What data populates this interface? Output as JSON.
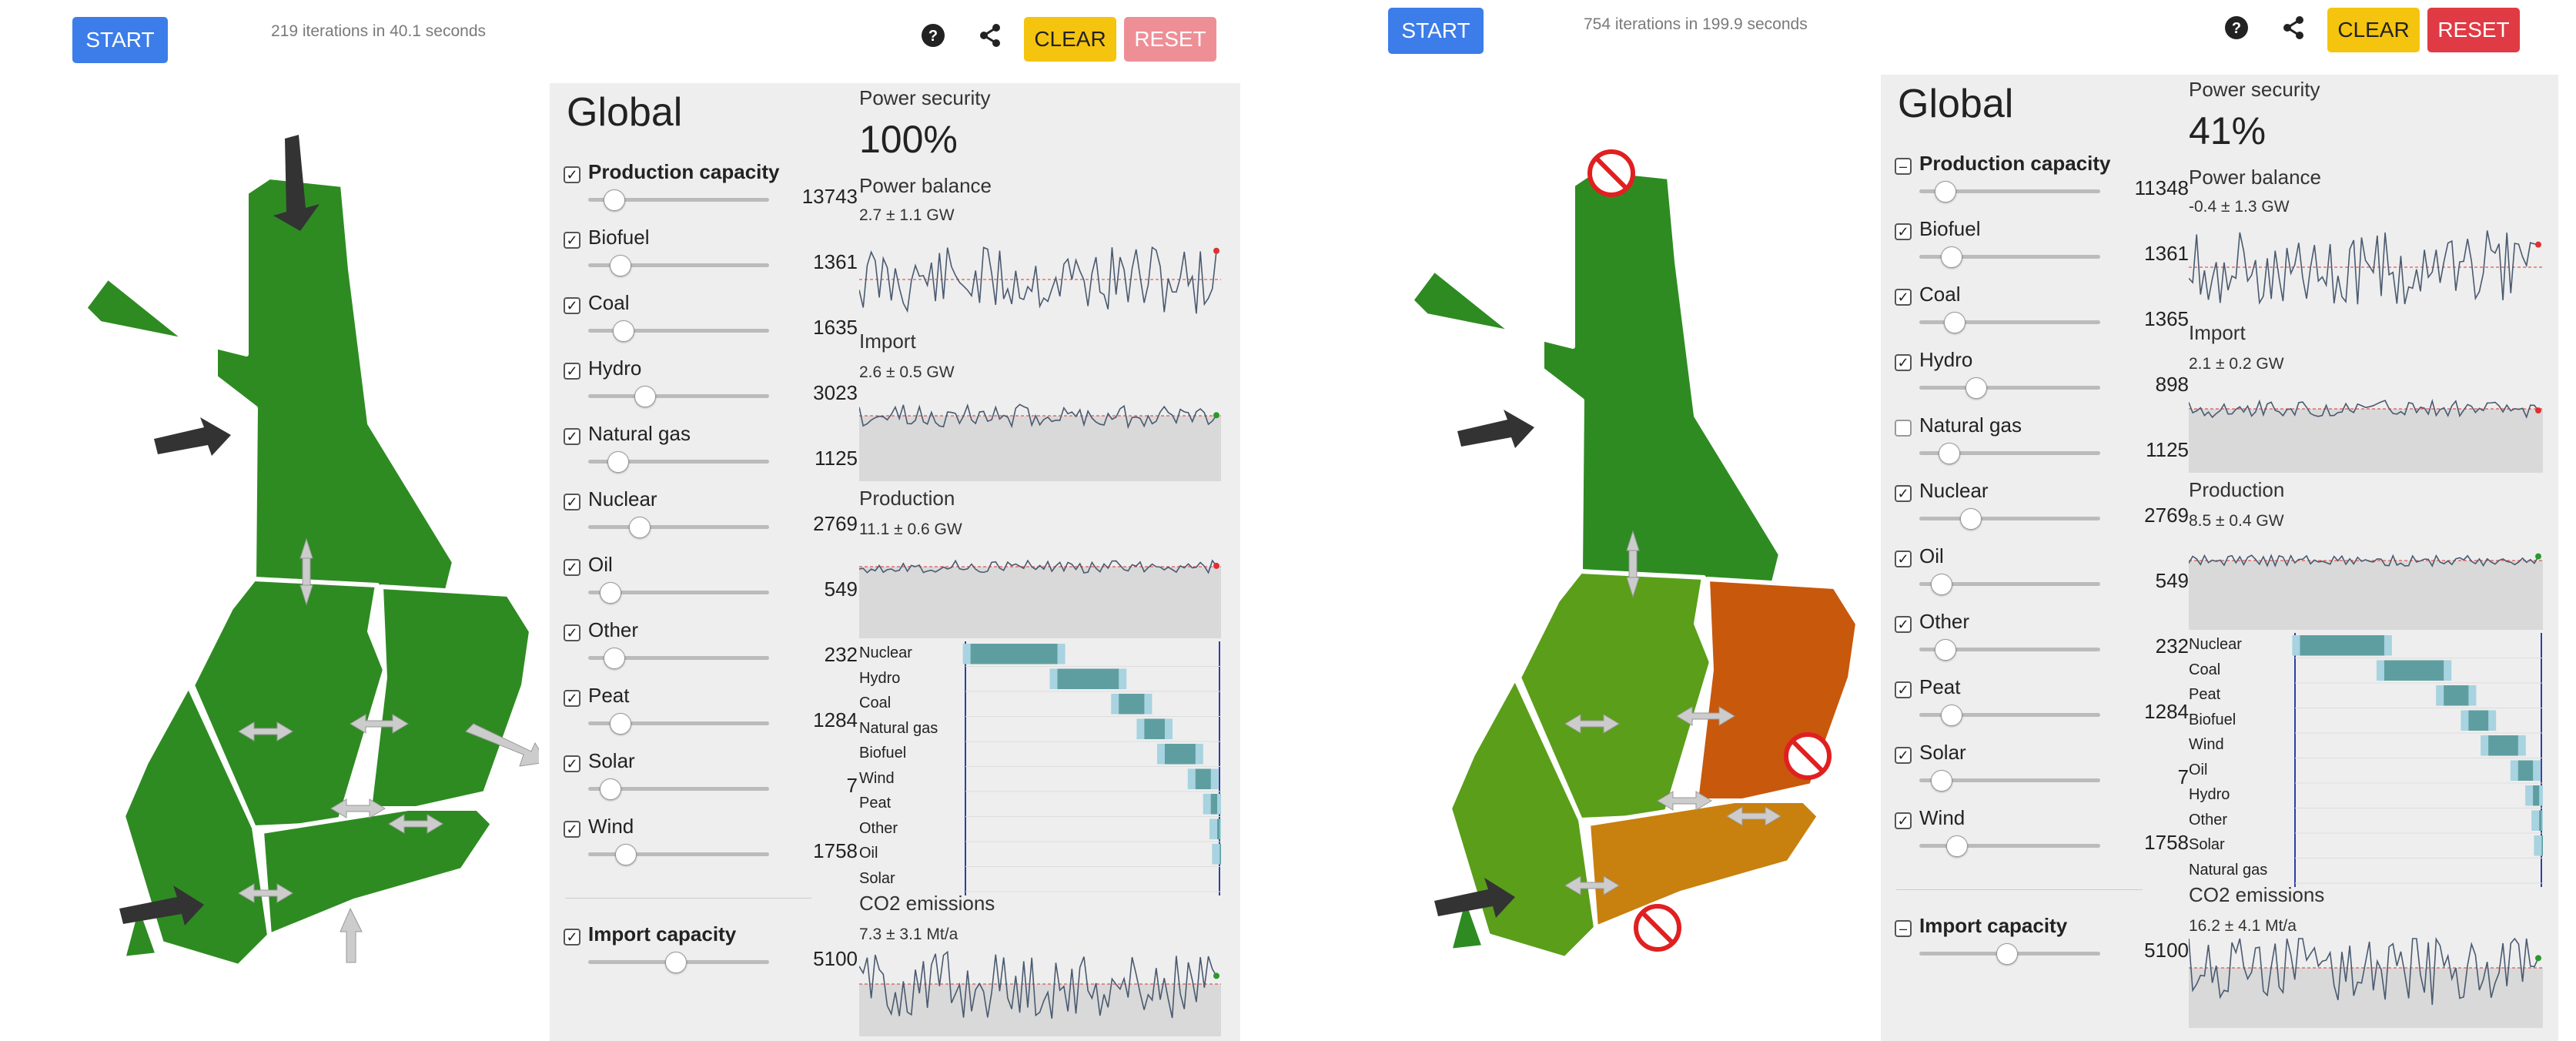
{
  "left": {
    "start_label": "START",
    "iterations": "219 iterations in 40.1 seconds",
    "clear_label": "CLEAR",
    "reset_label": "RESET",
    "reset_color": "#ee8f96",
    "panel": {
      "title": "Global",
      "production_capacity": {
        "label": "Production capacity",
        "value": "13743",
        "state": "checked"
      },
      "sources": [
        {
          "label": "Biofuel",
          "value": "1361",
          "checked": true
        },
        {
          "label": "Coal",
          "value": "1635",
          "checked": true
        },
        {
          "label": "Hydro",
          "value": "3023",
          "checked": true
        },
        {
          "label": "Natural gas",
          "value": "1125",
          "checked": true
        },
        {
          "label": "Nuclear",
          "value": "2769",
          "checked": true
        },
        {
          "label": "Oil",
          "value": "549",
          "checked": true
        },
        {
          "label": "Other",
          "value": "232",
          "checked": true
        },
        {
          "label": "Peat",
          "value": "1284",
          "checked": true
        },
        {
          "label": "Solar",
          "value": "7",
          "checked": true
        },
        {
          "label": "Wind",
          "value": "1758",
          "checked": true
        }
      ],
      "import_capacity": {
        "label": "Import capacity",
        "value": "5100",
        "state": "checked"
      },
      "power_security_label": "Power security",
      "power_security_value": "100%",
      "power_balance_label": "Power balance",
      "power_balance_stat": "2.7 ± 1.1 GW",
      "import_label": "Import",
      "import_stat": "2.6 ± 0.5 GW",
      "production_label": "Production",
      "production_stat": "11.1 ± 0.6 GW",
      "merit_order": [
        "Nuclear",
        "Hydro",
        "Coal",
        "Natural gas",
        "Biofuel",
        "Wind",
        "Peat",
        "Other",
        "Oil",
        "Solar"
      ],
      "co2_label": "CO2 emissions",
      "co2_stat": "7.3 ± 3.1 Mt/a"
    }
  },
  "right": {
    "start_label": "START",
    "iterations": "754 iterations in 199.9 seconds",
    "clear_label": "CLEAR",
    "reset_label": "RESET",
    "reset_color": "#e03a44",
    "panel": {
      "title": "Global",
      "production_capacity": {
        "label": "Production capacity",
        "value": "11348",
        "state": "indeterminate"
      },
      "sources": [
        {
          "label": "Biofuel",
          "value": "1361",
          "checked": true
        },
        {
          "label": "Coal",
          "value": "1365",
          "checked": true
        },
        {
          "label": "Hydro",
          "value": "898",
          "checked": true
        },
        {
          "label": "Natural gas",
          "value": "1125",
          "checked": false
        },
        {
          "label": "Nuclear",
          "value": "2769",
          "checked": true
        },
        {
          "label": "Oil",
          "value": "549",
          "checked": true
        },
        {
          "label": "Other",
          "value": "232",
          "checked": true
        },
        {
          "label": "Peat",
          "value": "1284",
          "checked": true
        },
        {
          "label": "Solar",
          "value": "7",
          "checked": true
        },
        {
          "label": "Wind",
          "value": "1758",
          "checked": true
        }
      ],
      "import_capacity": {
        "label": "Import capacity",
        "value": "5100",
        "state": "indeterminate"
      },
      "power_security_label": "Power security",
      "power_security_value": "41%",
      "power_balance_label": "Power balance",
      "power_balance_stat": "-0.4 ± 1.3 GW",
      "import_label": "Import",
      "import_stat": "2.1 ± 0.2 GW",
      "production_label": "Production",
      "production_stat": "8.5 ± 0.4 GW",
      "merit_order": [
        "Nuclear",
        "Coal",
        "Peat",
        "Biofuel",
        "Wind",
        "Oil",
        "Hydro",
        "Other",
        "Solar",
        "Natural gas"
      ],
      "co2_label": "CO2 emissions",
      "co2_stat": "16.2 ± 4.1 Mt/a"
    }
  },
  "colors": {
    "start": "#3d7de9",
    "clear": "#f5c40f",
    "map_green": "#2e8b22",
    "map_light_green": "#5a9e1a",
    "map_orange": "#c8580c",
    "map_amber": "#c8800f",
    "merit_bar": "#5f9ea0",
    "merit_bar_light": "#a8d3e0"
  },
  "icons": [
    "help-icon",
    "share-icon",
    "arrow-icon",
    "no-entry-icon"
  ]
}
